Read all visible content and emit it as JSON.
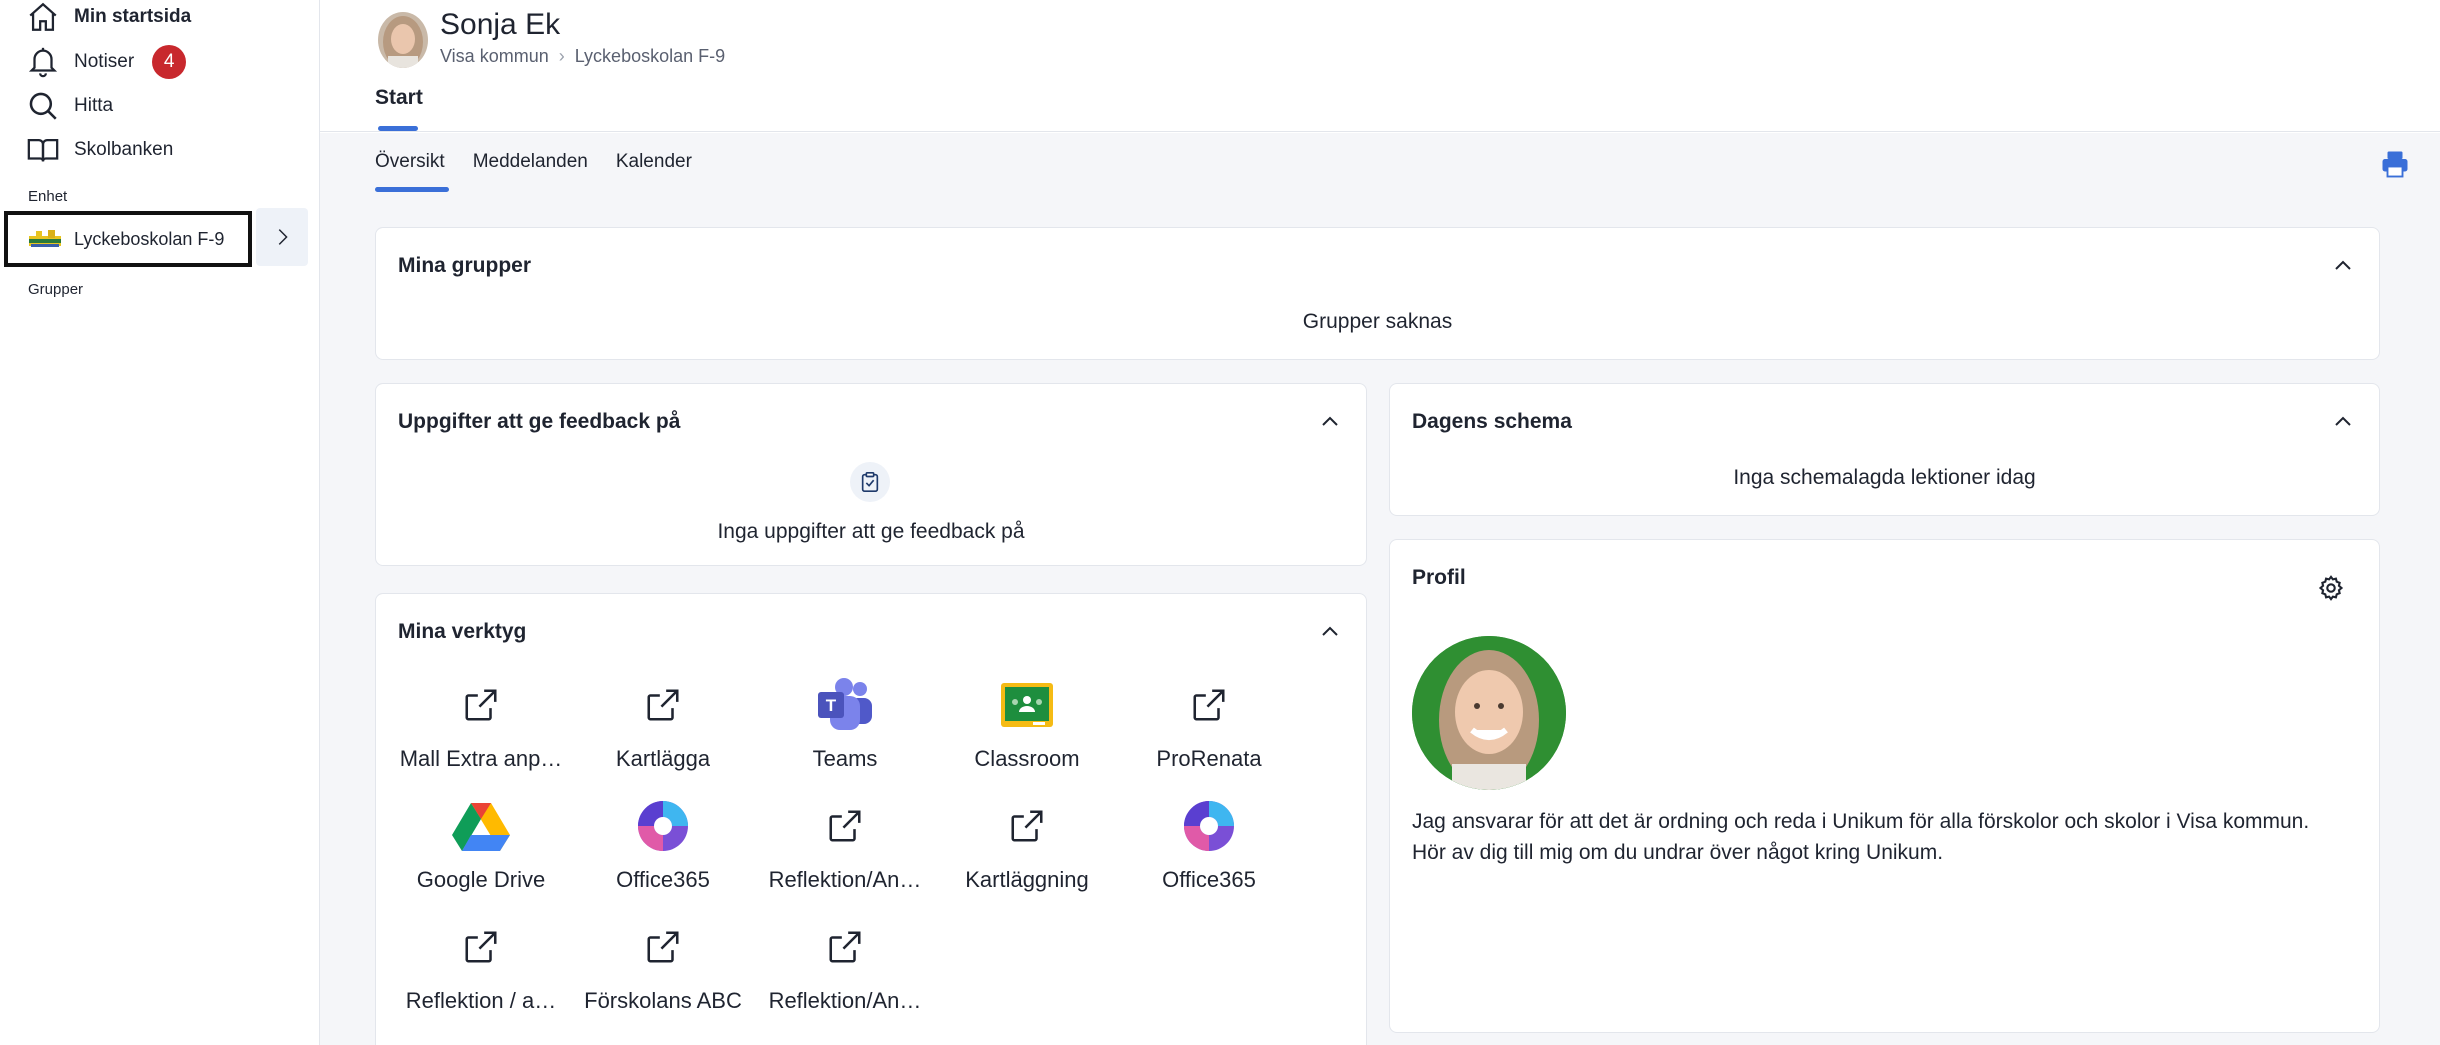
{
  "sidebar": {
    "items": [
      {
        "label": "Min startsida",
        "icon": "home-icon"
      },
      {
        "label": "Notiser",
        "icon": "bell-icon",
        "badge": "4"
      },
      {
        "label": "Hitta",
        "icon": "search-icon"
      },
      {
        "label": "Skolbanken",
        "icon": "book-icon"
      }
    ],
    "unit_section_label": "Enhet",
    "unit_name": "Lyckeboskolan F-9",
    "groups_section_label": "Grupper"
  },
  "header": {
    "user_name": "Sonja Ek",
    "breadcrumb": [
      "Visa kommun",
      "Lyckeboskolan F-9"
    ],
    "tab": "Start"
  },
  "subtabs": [
    "Översikt",
    "Meddelanden",
    "Kalender"
  ],
  "cards": {
    "groups": {
      "title": "Mina grupper",
      "message": "Grupper saknas"
    },
    "feedback": {
      "title": "Uppgifter att ge feedback på",
      "message": "Inga uppgifter att ge feedback på"
    },
    "schedule": {
      "title": "Dagens schema",
      "message": "Inga schemalagda lektioner idag"
    },
    "tools": {
      "title": "Mina verktyg",
      "items": [
        {
          "label": "Mall Extra anp…",
          "icon": "external-link-icon"
        },
        {
          "label": "Kartlägga",
          "icon": "external-link-icon"
        },
        {
          "label": "Teams",
          "icon": "teams-icon"
        },
        {
          "label": "Classroom",
          "icon": "classroom-icon"
        },
        {
          "label": "ProRenata",
          "icon": "external-link-icon"
        },
        {
          "label": "Google Drive",
          "icon": "google-drive-icon"
        },
        {
          "label": "Office365",
          "icon": "office365-icon"
        },
        {
          "label": "Reflektion/An…",
          "icon": "external-link-icon"
        },
        {
          "label": "Kartläggning",
          "icon": "external-link-icon"
        },
        {
          "label": "Office365",
          "icon": "office365-icon"
        },
        {
          "label": "Reflektion / a…",
          "icon": "external-link-icon"
        },
        {
          "label": "Förskolans ABC",
          "icon": "external-link-icon"
        },
        {
          "label": "Reflektion/An…",
          "icon": "external-link-icon"
        }
      ]
    },
    "profile": {
      "title": "Profil",
      "text_line1": "Jag ansvarar för att det är ordning och reda i Unikum för alla förskolor och skolor i Visa kommun.",
      "text_line2": "Hör av dig till mig om du undrar över något kring Unikum."
    }
  },
  "colors": {
    "accent": "#3a6fd8",
    "badge": "#c8282d",
    "background": "#f5f6f9"
  }
}
